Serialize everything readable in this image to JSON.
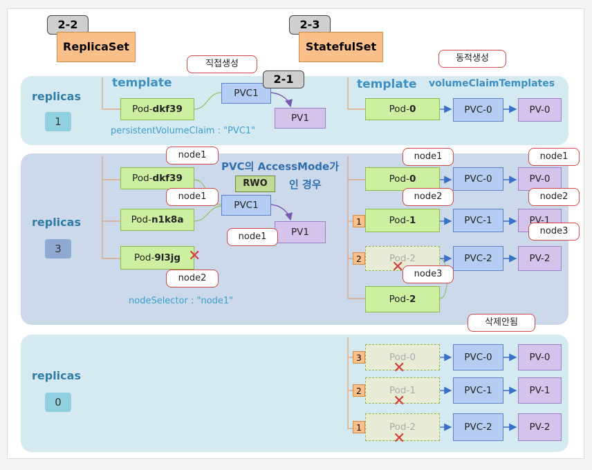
{
  "headers": {
    "replicaset_num": "2-2",
    "replicaset_label": "ReplicaSet",
    "statefulset_num": "2-3",
    "statefulset_label": "StatefulSet"
  },
  "section1": {
    "replicas_label": "replicas",
    "replicas_value": "1",
    "rs_template": "template",
    "rs_pod_prefix": "Pod-",
    "rs_pod_bold": "dkf39",
    "rs_pvc": "PVC1",
    "rs_pv": "PV1",
    "callout_direct": "직접생성",
    "tag_21": "2-1",
    "pvc_claim_note": "persistentVolumeClaim  : \"PVC1\"",
    "ss_template": "template",
    "vct_label": "volumeClaimTemplates",
    "callout_dynamic": "동적생성",
    "ss_pod_prefix": "Pod-",
    "ss_pod_bold": "0",
    "ss_pvc": "PVC-0",
    "ss_pv": "PV-0"
  },
  "section2": {
    "replicas_label": "replicas",
    "replicas_value": "3",
    "rs_pods": [
      {
        "prefix": "Pod-",
        "bold": "dkf39",
        "node": "node1"
      },
      {
        "prefix": "Pod-",
        "bold": "n1k8a",
        "node": "node1"
      },
      {
        "prefix": "Pod-",
        "bold": "9l3jg",
        "node": "node2"
      }
    ],
    "rs_pvc": "PVC1",
    "rs_pv": "PV1",
    "pvc_node": "node1",
    "access_line1": "PVC의 AccessMode가",
    "access_rwo": "RWO",
    "access_line2": "인 경우",
    "node_selector": "nodeSelector  : \"node1\"",
    "ss_rows": [
      {
        "ord": "",
        "pod": "Pod-0",
        "pod_bold": "0",
        "pod_node": "node1",
        "pvc": "PVC-0",
        "pv": "PV-0",
        "pv_node": "node1"
      },
      {
        "ord": "1",
        "pod": "Pod-1",
        "pod_bold": "1",
        "pod_node": "node2",
        "pvc": "PVC-1",
        "pv": "PV-1",
        "pv_node": "node2"
      },
      {
        "ord": "2",
        "pod": "Pod-2",
        "pod_bold": "",
        "pod_node": "",
        "pvc": "PVC-2",
        "pv": "PV-2",
        "pv_node": "node3"
      }
    ],
    "ss_new_pod_prefix": "Pod-",
    "ss_new_pod_bold": "2",
    "ss_new_pod_node": "node3"
  },
  "section3": {
    "replicas_label": "replicas",
    "replicas_value": "0",
    "callout_not_deleted": "삭제안됨",
    "rows": [
      {
        "ord": "3",
        "pod": "Pod-0",
        "pvc": "PVC-0",
        "pv": "PV-0"
      },
      {
        "ord": "2",
        "pod": "Pod-1",
        "pvc": "PVC-1",
        "pv": "PV-1"
      },
      {
        "ord": "1",
        "pod": "Pod-2",
        "pvc": "PVC-2",
        "pv": "PV-2"
      }
    ]
  },
  "colors": {
    "pod": "#ccf0a0",
    "pvc": "#b5cdf3",
    "pv": "#d4c3ea",
    "panel_light": "#d5e9f1",
    "panel_dark": "#ccd9eb",
    "accent_text": "#3b8fc2",
    "delete_mark": "#d83a3a"
  }
}
